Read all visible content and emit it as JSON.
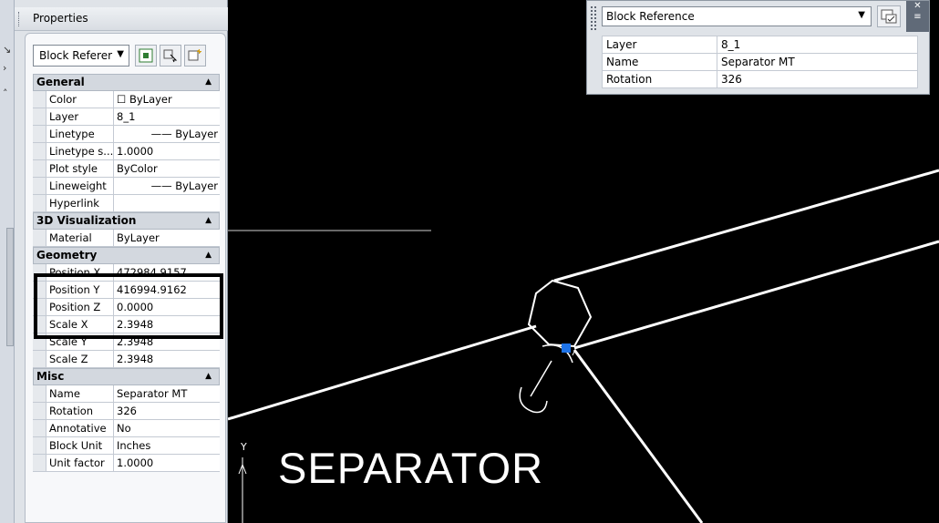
{
  "palette": {
    "title": "Properties",
    "selector": "Block Referer",
    "sections": [
      {
        "title": "General",
        "rows": [
          {
            "name": "Color",
            "value": "☐ ByLayer"
          },
          {
            "name": "Layer",
            "value": "8_1"
          },
          {
            "name": "Linetype",
            "value": "—— ByLayer"
          },
          {
            "name": "Linetype s...",
            "value": "1.0000"
          },
          {
            "name": "Plot style",
            "value": "ByColor"
          },
          {
            "name": "Lineweight",
            "value": "—— ByLayer"
          },
          {
            "name": "Hyperlink",
            "value": ""
          }
        ]
      },
      {
        "title": "3D Visualization",
        "rows": [
          {
            "name": "Material",
            "value": "ByLayer"
          }
        ]
      },
      {
        "title": "Geometry",
        "rows": [
          {
            "name": "Position X",
            "value": "472984.9157"
          },
          {
            "name": "Position Y",
            "value": "416994.9162"
          },
          {
            "name": "Position Z",
            "value": "0.0000"
          },
          {
            "name": "Scale X",
            "value": "2.3948"
          },
          {
            "name": "Scale Y",
            "value": "2.3948"
          },
          {
            "name": "Scale Z",
            "value": "2.3948"
          }
        ]
      },
      {
        "title": "Misc",
        "rows": [
          {
            "name": "Name",
            "value": "Separator MT"
          },
          {
            "name": "Rotation",
            "value": "326"
          },
          {
            "name": "Annotative",
            "value": "No"
          },
          {
            "name": "Block Unit",
            "value": "Inches"
          },
          {
            "name": "Unit factor",
            "value": "1.0000"
          }
        ]
      }
    ]
  },
  "quick_properties": {
    "selector": "Block Reference",
    "rows": [
      {
        "name": "Layer",
        "value": "8_1"
      },
      {
        "name": "Name",
        "value": "Separator MT"
      },
      {
        "name": "Rotation",
        "value": "326"
      }
    ]
  },
  "drawing": {
    "text": "SEPARATOR",
    "ucs_label": "Y"
  },
  "colors": {
    "canvas_bg": "#000000",
    "grip": "#1e73e8",
    "highlight": "#000000"
  }
}
